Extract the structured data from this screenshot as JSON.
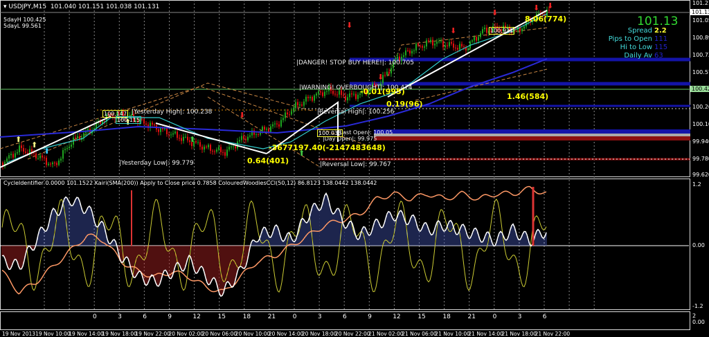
{
  "header": {
    "symbol": "USDJPY,M15",
    "open": "101.040",
    "high": "101.151",
    "low": "101.038",
    "close": "101.131"
  },
  "fiveday": {
    "high": "5dayH 100.425",
    "low": "5dayL 99.561"
  },
  "info": {
    "price": "101.13",
    "spread_label": "Spread",
    "spread": "2.2",
    "pips_open_label": "Pips to Open",
    "pips_open": "111",
    "hi_low_label": "Hi to Low",
    "hi_low": "115",
    "daily_av_label": "Daily Av",
    "daily_av": "63"
  },
  "levels": {
    "danger": "|DANGER! STOP BUY HERE!|: 100.705",
    "warning": "|WARNING! OVERBOUGHT|: 100.474",
    "rev_high": "|Reversal High|: 100.256",
    "rev_low": "|Reversal Low|: 99.767",
    "yest_low": "|Yesterday Low|: 99.779",
    "yest_high": "|Yesterday High|: 100.238",
    "mid_a": "|Last Open|: 100.05",
    "mid_b": "|Day Open|: 99.975"
  },
  "annotations": {
    "a1": "8.06(774)",
    "a2": "-0.01(995)",
    "a3": "0.19(96)",
    "a4": "1.46(584)",
    "a5": "-3677197.40(-2147483648)",
    "a6": "0.64(401)"
  },
  "boxes": {
    "b1": "100.931",
    "b2": "100.147",
    "b3": "100.115",
    "b4": "100.033"
  },
  "price_axis": [
    "101.215",
    "101.055",
    "100.895",
    "100.735",
    "100.575",
    "100.425",
    "100.260",
    "100.100",
    "99.940",
    "99.780",
    "99.620"
  ],
  "price_axis_current": "101.131",
  "price_axis_green": "100.425",
  "indicator": {
    "title": "CycleIdentifier 0.0000 101.1522  Kairi(SMA(200)) Apply to Close price 0.7858  ColouredWoodiesCCI(50,12) 86.8123 138.0442 138.0442",
    "axis": [
      "1.2",
      "0.00",
      "-1.2"
    ]
  },
  "hour_axis": {
    "labels": [
      "0",
      "3",
      "6",
      "9",
      "12",
      "15",
      "18",
      "21",
      "0",
      "3",
      "6",
      "9",
      "12",
      "15",
      "18",
      "21",
      "0",
      "3",
      "6"
    ],
    "right_top": "2",
    "right_bottom": "0.00"
  },
  "time_axis": [
    "19 Nov 2013",
    "19 Nov 10:00",
    "19 Nov 14:00",
    "19 Nov 18:00",
    "19 Nov 22:00",
    "20 Nov 02:00",
    "20 Nov 06:00",
    "20 Nov 10:00",
    "20 Nov 14:00",
    "20 Nov 18:00",
    "20 Nov 22:00",
    "21 Nov 02:00",
    "21 Nov 06:00",
    "21 Nov 10:00",
    "21 Nov 14:00",
    "21 Nov 18:00",
    "21 Nov 22:00"
  ],
  "colors": {
    "bull": "#1fa51f",
    "bear": "#e01010",
    "ma": "#1b1bb8",
    "info_price": "#33dd33",
    "annotation": "#ffff33"
  },
  "chart_data": {
    "type": "candlestick",
    "symbol": "USDJPY",
    "timeframe": "M15",
    "ylim": [
      99.62,
      101.215
    ],
    "closes": [
      99.736,
      99.865,
      99.8,
      99.704,
      99.929,
      100.025,
      100.154,
      100.186,
      100.122,
      100.058,
      99.993,
      99.929,
      99.865,
      99.833,
      99.961,
      100.025,
      100.09,
      100.25,
      100.347,
      100.411,
      100.347,
      100.379,
      100.476,
      100.7,
      100.797,
      100.861,
      100.829,
      100.797,
      100.958,
      100.99,
      100.958,
      101.086,
      101.151
    ],
    "oscillator": {
      "ylim": [
        -1.2,
        1.2
      ],
      "histogram": [
        -0.3,
        -0.4,
        0.1,
        0.6,
        0.9,
        0.7,
        0.3,
        -0.2,
        -0.6,
        -0.7,
        -0.5,
        -0.3,
        -0.6,
        -0.9,
        -0.5,
        0.2,
        0.3,
        0.1,
        0.6,
        0.9,
        0.5,
        0.2,
        0.4,
        0.6,
        0.5,
        0.3,
        0.4,
        0.3,
        0.2,
        0.1,
        0.3,
        0.1,
        0.3
      ],
      "kairi": [
        -0.5,
        -0.9,
        -0.7,
        -0.4,
        -0.1,
        0.2,
        0.1,
        -0.3,
        -0.5,
        -0.6,
        -0.5,
        -0.6,
        -0.8,
        -0.9,
        -0.6,
        -0.3,
        -0.2,
        0.0,
        0.2,
        0.4,
        0.5,
        0.6,
        0.9,
        1.0,
        0.9,
        1.0,
        0.9,
        1.0,
        0.9,
        1.0,
        1.0,
        1.1,
        1.0
      ]
    }
  }
}
